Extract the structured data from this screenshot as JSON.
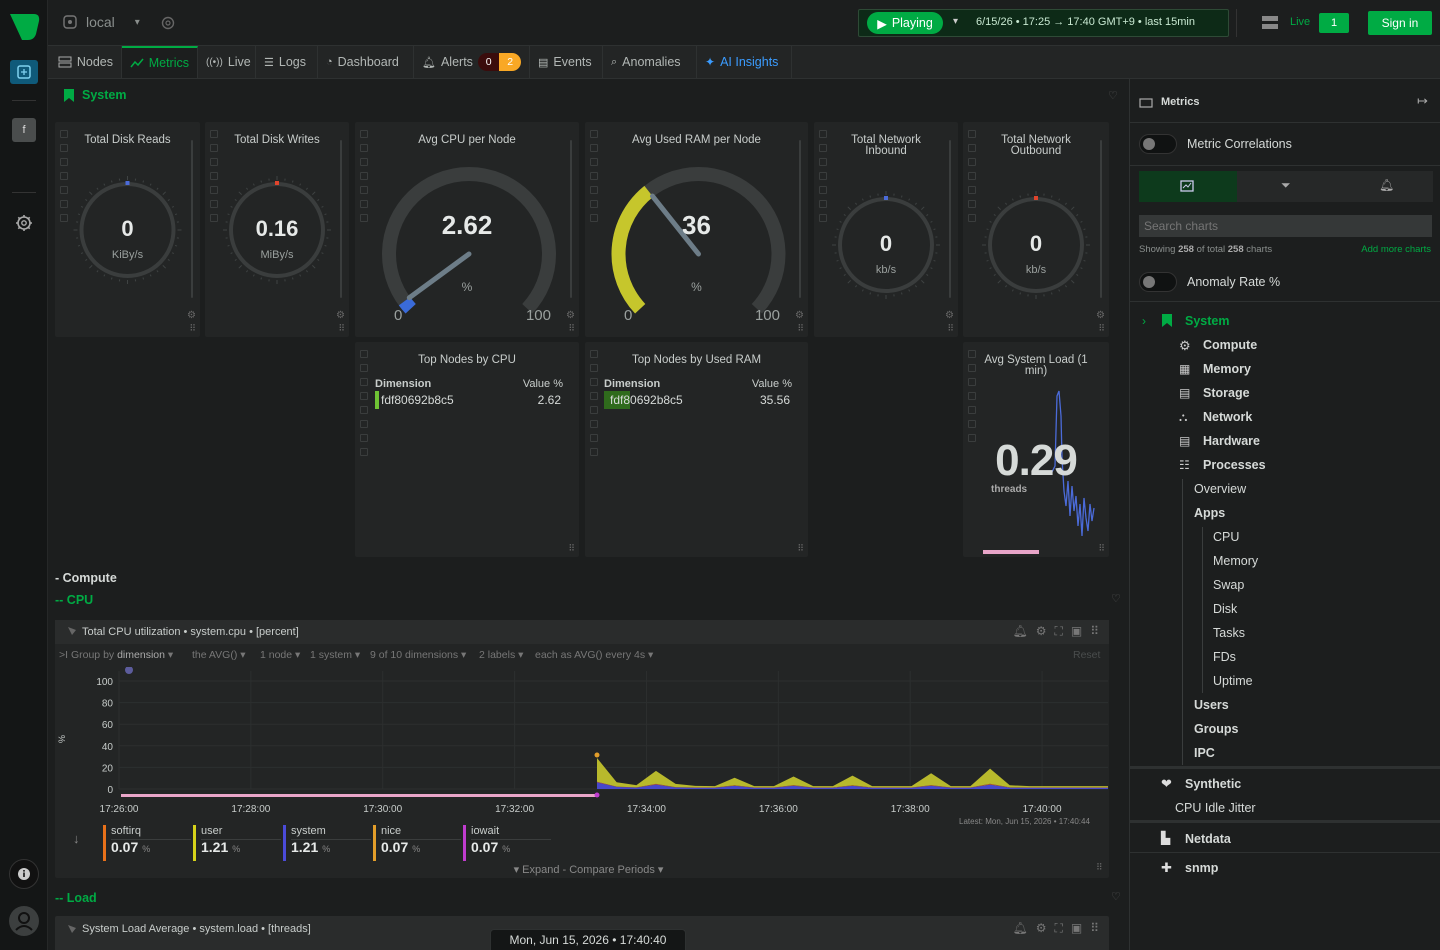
{
  "topbar": {
    "space": "local",
    "playing": "Playing",
    "timerange": "6/15/26 • 17:25 → 17:40 GMT+9 • last 15min",
    "live_label": "Live",
    "live_count": "1",
    "signin": "Sign in"
  },
  "tabs": [
    {
      "label": "Nodes"
    },
    {
      "label": "Metrics"
    },
    {
      "label": "Live"
    },
    {
      "label": "Logs"
    },
    {
      "label": "Dashboard"
    },
    {
      "label": "Alerts"
    },
    {
      "label": "Events"
    },
    {
      "label": "Anomalies"
    },
    {
      "label": "AI Insights"
    }
  ],
  "alerts": {
    "critical": "0",
    "warning": "2"
  },
  "section": {
    "system": "System",
    "compute": "- Compute",
    "cpu": "-- CPU",
    "load": "-- Load"
  },
  "gauges": [
    {
      "title": "Total Disk Reads",
      "value": "0",
      "unit": "KiBy/s"
    },
    {
      "title": "Total Disk Writes",
      "value": "0.16",
      "unit": "MiBy/s"
    },
    {
      "title": "Avg CPU per Node",
      "value": "2.62",
      "unit": "%",
      "min": "0",
      "max": "100",
      "level": 0.0262
    },
    {
      "title": "Avg Used RAM per Node",
      "value": "36",
      "unit": "%",
      "min": "0",
      "max": "100",
      "level": 0.3556
    },
    {
      "title": "Total Network Inbound",
      "value": "0",
      "unit": "kb/s"
    },
    {
      "title": "Total Network Outbound",
      "value": "0",
      "unit": "kb/s"
    }
  ],
  "topnodes": [
    {
      "title": "Top Nodes by CPU",
      "dim_header": "Dimension",
      "val_header": "Value %",
      "node": "fdf80692b8c5",
      "value": "2.62"
    },
    {
      "title": "Top Nodes by Used RAM",
      "dim_header": "Dimension",
      "val_header": "Value %",
      "node": "fdf80692b8c5",
      "value": "35.56"
    }
  ],
  "sysload": {
    "title": "Avg System Load (1 min)",
    "value": "0.29",
    "unit": "threads"
  },
  "cpu_chart": {
    "title": "Total CPU utilization • system.cpu • [percent]",
    "group_prefix": "Group by",
    "group_by": "dimension",
    "agg": "the AVG()",
    "nodes": "1 node",
    "systems": "1 system",
    "dims": "9 of 10 dimensions",
    "labels": "2 labels",
    "each": "each as AVG() every 4s",
    "reset": "Reset",
    "latest": "Latest: Mon, Jun 15, 2026 • 17:40:44",
    "expand": "Expand - Compare Periods",
    "yaxis_unit": "%"
  },
  "chart_data": {
    "type": "area",
    "title": "Total CPU utilization",
    "ylabel": "%",
    "ylim": [
      0,
      100
    ],
    "yticks": [
      "100",
      "80",
      "60",
      "40",
      "20",
      "0"
    ],
    "xticks": [
      "17:26:00",
      "17:28:00",
      "17:30:00",
      "17:32:00",
      "17:34:00",
      "17:36:00",
      "17:38:00",
      "17:40:00"
    ],
    "x": [
      0,
      20,
      40,
      60,
      80,
      100,
      120,
      140,
      160,
      180,
      200,
      220,
      240,
      260,
      280,
      300,
      320,
      340,
      360,
      380,
      400,
      420,
      440,
      460,
      480,
      500,
      520
    ],
    "series": [
      {
        "name": "softirq",
        "color": "#e8711a",
        "values": [
          0.3,
          0.1,
          0.07,
          0.5,
          0.1,
          0.07,
          0.07,
          0.3,
          0.07,
          0.07,
          0.4,
          0.07,
          0.07,
          0.3,
          0.07,
          0.07,
          0.07,
          0.4,
          0.07,
          0.07,
          0.6,
          0.07,
          0.07,
          0.07,
          0.07,
          0.07,
          0.07
        ]
      },
      {
        "name": "user",
        "color": "#c6c62c",
        "values": [
          22,
          4,
          2,
          12,
          3,
          1.5,
          1.2,
          7,
          1.3,
          1.2,
          8,
          1.2,
          1.2,
          9,
          1.2,
          1.2,
          1.2,
          11,
          1.3,
          1.2,
          14,
          2,
          1.2,
          1.2,
          1.3,
          1.2,
          1.21
        ]
      },
      {
        "name": "system",
        "color": "#4b4bd9",
        "values": [
          6,
          2,
          1.3,
          4,
          1.5,
          1.2,
          1.2,
          3,
          1.2,
          1.2,
          3,
          1.2,
          1.2,
          3,
          1.2,
          1.2,
          1.2,
          3,
          1.2,
          1.2,
          4,
          1.3,
          1.2,
          1.2,
          1.2,
          1.2,
          1.21
        ]
      },
      {
        "name": "nice",
        "color": "#e39e2a",
        "values": [
          0.1,
          0.07,
          0.07,
          0.07,
          0.07,
          0.07,
          0.07,
          0.07,
          0.07,
          0.07,
          0.07,
          0.07,
          0.07,
          0.07,
          0.07,
          0.07,
          0.07,
          0.07,
          0.07,
          0.07,
          0.07,
          0.07,
          0.07,
          0.07,
          0.07,
          0.07,
          0.07
        ]
      },
      {
        "name": "iowait",
        "color": "#c03ccf",
        "values": [
          0.3,
          0.07,
          0.07,
          0.2,
          0.07,
          0.07,
          0.07,
          0.07,
          0.07,
          0.07,
          0.1,
          0.07,
          0.07,
          0.07,
          0.07,
          0.07,
          0.07,
          0.07,
          0.07,
          0.07,
          0.2,
          0.07,
          0.07,
          0.07,
          0.07,
          0.07,
          0.07
        ]
      }
    ]
  },
  "legend": [
    {
      "name": "softirq",
      "value": "0.07",
      "unit": "%",
      "color": "#e8711a"
    },
    {
      "name": "user",
      "value": "1.21",
      "unit": "%",
      "color": "#d6d21a"
    },
    {
      "name": "system",
      "value": "1.21",
      "unit": "%",
      "color": "#4b4bd9"
    },
    {
      "name": "nice",
      "value": "0.07",
      "unit": "%",
      "color": "#e39e2a"
    },
    {
      "name": "iowait",
      "value": "0.07",
      "unit": "%",
      "color": "#c03ccf"
    }
  ],
  "load_chart": {
    "title": "System Load Average • system.load • [threads]"
  },
  "footer_time": "Mon, Jun 15, 2026 • 17:40:40",
  "rpanel": {
    "title": "Metrics",
    "metric_corr": "Metric Correlations",
    "search_placeholder": "Search charts",
    "showing_a": "Showing",
    "showing_n": "258",
    "showing_b": "of total",
    "showing_t": "258",
    "showing_c": "charts",
    "add_more": "Add more charts",
    "anomaly": "Anomaly Rate %",
    "tree": {
      "system": "System",
      "compute": "Compute",
      "memory": "Memory",
      "storage": "Storage",
      "network": "Network",
      "hardware": "Hardware",
      "processes": "Processes",
      "overview": "Overview",
      "apps": "Apps",
      "apps_items": [
        "CPU",
        "Memory",
        "Swap",
        "Disk",
        "Tasks",
        "FDs",
        "Uptime"
      ],
      "users": "Users",
      "groups": "Groups",
      "ipc": "IPC",
      "synthetic": "Synthetic",
      "cpu_idle": "CPU Idle Jitter",
      "netdata": "Netdata",
      "snmp": "snmp"
    }
  },
  "colors": {
    "accent": "#00ab44",
    "ai": "#3b9cff",
    "bg": "#1c1e1e",
    "card": "#232525"
  }
}
